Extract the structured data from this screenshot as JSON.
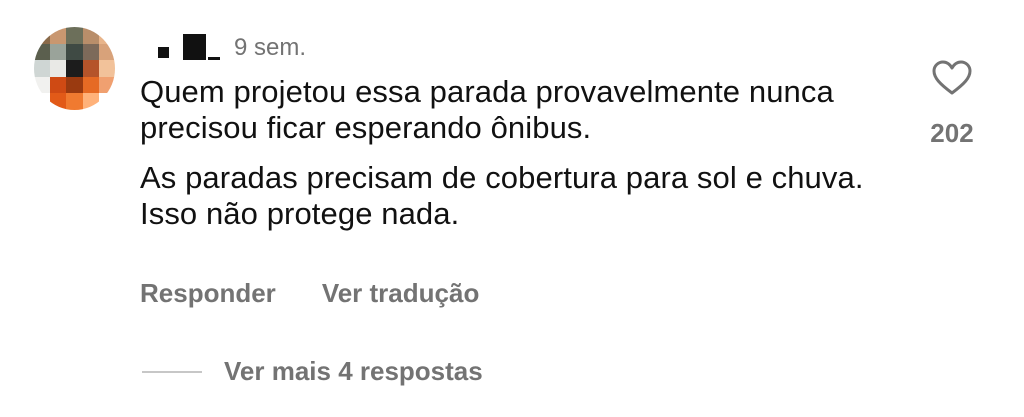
{
  "comment": {
    "username_redacted": true,
    "time_ago": "9 sem.",
    "paragraphs": [
      "Quem projetou essa parada provavelmente nunca precisou ficar esperando ônibus.",
      "As paradas precisam de cobertura para sol e chuva. Isso não protege nada."
    ],
    "like_count": "202",
    "actions": {
      "reply_label": "Responder",
      "translate_label": "Ver tradução"
    },
    "more_replies_label": "Ver mais 4 respostas"
  },
  "icons": {
    "like": "heart-outline-icon"
  },
  "colors": {
    "text_primary": "#111111",
    "text_secondary": "#737373",
    "divider": "#c7c7c7",
    "avatar_pixels": [
      "#8a6a4a",
      "#c99770",
      "#6c6f5a",
      "#b98e6a",
      "#e8b48a",
      "#5b5f4e",
      "#9aa39a",
      "#3f4a44",
      "#7d6a5a",
      "#d8a27a",
      "#cfd6d4",
      "#e9e9e6",
      "#1c1c1c",
      "#b5542a",
      "#f2c29a",
      "#f1f1ef",
      "#cf4a14",
      "#9a3a10",
      "#e66a24",
      "#f0a070",
      "#ffffff",
      "#e25a18",
      "#f07a30",
      "#ffb27a",
      "#ffffff"
    ]
  }
}
